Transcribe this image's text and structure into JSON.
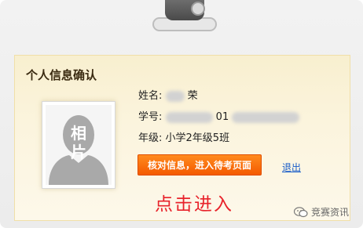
{
  "panel": {
    "title": "个人信息确认"
  },
  "photo": {
    "placeholder_label_line1": "相",
    "placeholder_label_line2": "片"
  },
  "info": {
    "name_label": "姓名:",
    "name_visible": "荣",
    "id_label": "学号:",
    "id_visible": "01",
    "grade_label": "年级:",
    "grade_value": "小学2年级5班"
  },
  "actions": {
    "enter_label": "核对信息，进入待考页面",
    "logout_label": "退出"
  },
  "hint": {
    "text": "点击进入"
  },
  "watermark": {
    "text": "竞赛资讯"
  },
  "colors": {
    "button": "#f45a00",
    "hint": "#e8222a",
    "link": "#1a5dc8",
    "panel_bg": "#fbf4dd"
  }
}
